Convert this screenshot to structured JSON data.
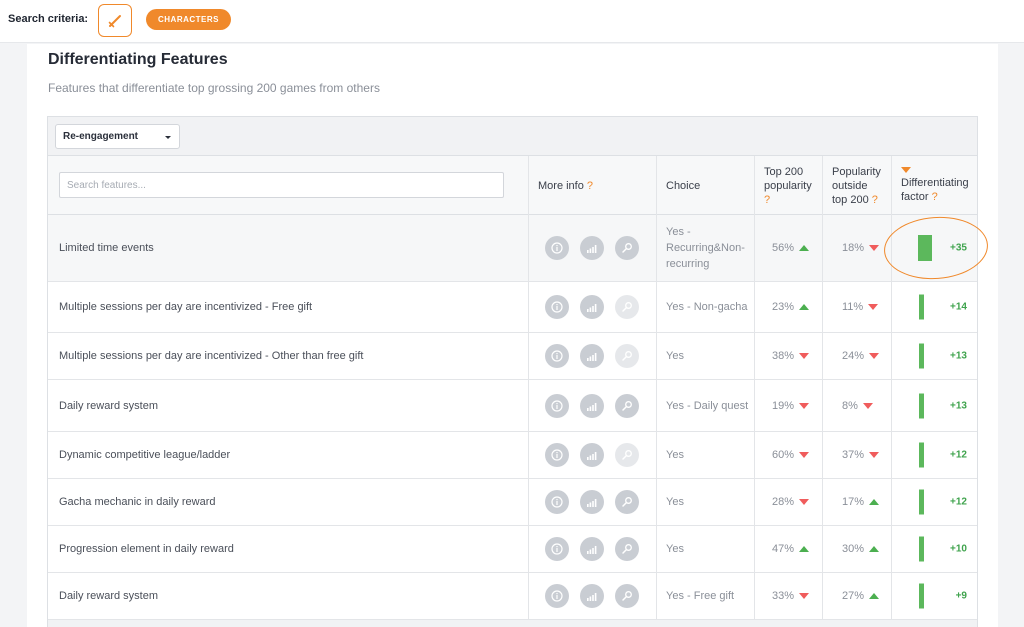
{
  "header": {
    "search_criteria_label": "Search criteria:",
    "criteria_icon": "sword-icon",
    "chip_label": "CHARACTERS"
  },
  "section": {
    "title": "Differentiating Features",
    "subtitle": "Features that differentiate top grossing 200 games from others"
  },
  "filter": {
    "selected": "Re-engagement"
  },
  "search": {
    "placeholder": "Search features..."
  },
  "columns": {
    "more_info": "More info",
    "choice": "Choice",
    "top200_line1": "Top 200",
    "top200_line2": "popularity",
    "outside_line1": "Popularity",
    "outside_line2": "outside",
    "outside_line3": "top 200",
    "factor_line1": "Differentiating",
    "factor_line2": "factor",
    "help_mark": "?"
  },
  "colors": {
    "accent": "#f0892b",
    "positive": "#4caf50",
    "negative": "#f05c5c",
    "bar": "#5cb85c"
  },
  "rows": [
    {
      "feature": "Limited time events",
      "choice": "Yes - Recurring&Non-recurring",
      "top200": "56%",
      "top200_trend": "up",
      "outside": "18%",
      "outside_trend": "down",
      "factor": "+35",
      "factor_value": 35,
      "third_icon_enabled": true
    },
    {
      "feature": "Multiple sessions per day are incentivized - Free gift",
      "choice": "Yes - Non-gacha",
      "top200": "23%",
      "top200_trend": "up",
      "outside": "11%",
      "outside_trend": "down",
      "factor": "+14",
      "factor_value": 14,
      "third_icon_enabled": false
    },
    {
      "feature": "Multiple sessions per day are incentivized - Other than free gift",
      "choice": "Yes",
      "top200": "38%",
      "top200_trend": "down",
      "outside": "24%",
      "outside_trend": "down",
      "factor": "+13",
      "factor_value": 13,
      "third_icon_enabled": false
    },
    {
      "feature": "Daily reward system",
      "choice": "Yes - Daily quest",
      "top200": "19%",
      "top200_trend": "down",
      "outside": "8%",
      "outside_trend": "down",
      "factor": "+13",
      "factor_value": 13,
      "third_icon_enabled": true
    },
    {
      "feature": "Dynamic competitive league/ladder",
      "choice": "Yes",
      "top200": "60%",
      "top200_trend": "down",
      "outside": "37%",
      "outside_trend": "down",
      "factor": "+12",
      "factor_value": 12,
      "third_icon_enabled": false
    },
    {
      "feature": "Gacha mechanic in daily reward",
      "choice": "Yes",
      "top200": "28%",
      "top200_trend": "down",
      "outside": "17%",
      "outside_trend": "up",
      "factor": "+12",
      "factor_value": 12,
      "third_icon_enabled": true
    },
    {
      "feature": "Progression element in daily reward",
      "choice": "Yes",
      "top200": "47%",
      "top200_trend": "up",
      "outside": "30%",
      "outside_trend": "up",
      "factor": "+10",
      "factor_value": 10,
      "third_icon_enabled": true
    },
    {
      "feature": "Daily reward system",
      "choice": "Yes - Free gift",
      "top200": "33%",
      "top200_trend": "down",
      "outside": "27%",
      "outside_trend": "up",
      "factor": "+9",
      "factor_value": 9,
      "third_icon_enabled": true
    }
  ]
}
